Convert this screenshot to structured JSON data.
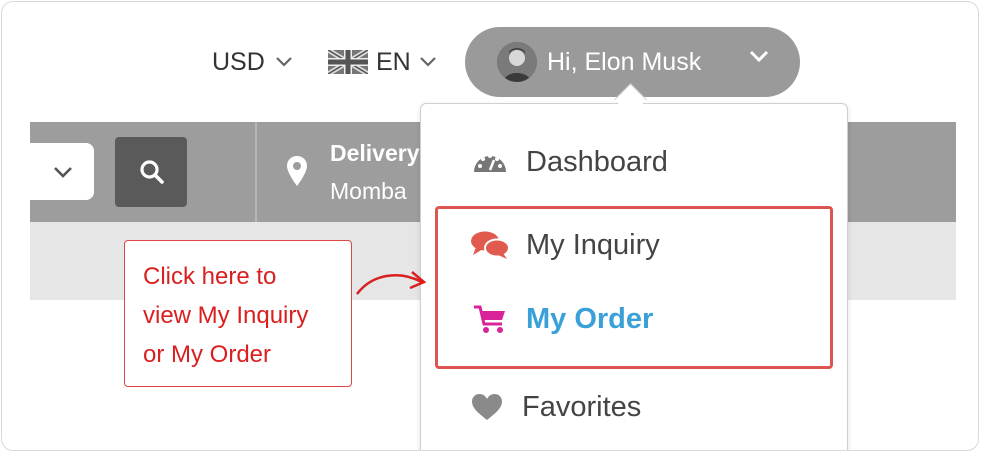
{
  "topbar": {
    "currency": "USD",
    "language": "EN",
    "user_greeting": "Hi, Elon Musk"
  },
  "header": {
    "delivery_title": "Delivery",
    "delivery_location": "Momba"
  },
  "user_menu": {
    "items": [
      {
        "label": "Dashboard",
        "icon": "dashboard-gauge-icon"
      },
      {
        "label": "My Inquiry",
        "icon": "chat-bubbles-icon"
      },
      {
        "label": "My Order",
        "icon": "shopping-cart-icon"
      },
      {
        "label": "Favorites",
        "icon": "heart-icon"
      }
    ]
  },
  "callout": {
    "lines": [
      "Click here to",
      "view My Inquiry",
      "or My Order"
    ]
  },
  "colors": {
    "pill": "#9a9a9a",
    "band": "#9d9d9d",
    "highlight": "#dd5550",
    "inquiry_icon": "#e05a4e",
    "order_icon": "#d9239b",
    "order_text": "#3aa0d8",
    "callout_text": "#d91f1f"
  }
}
